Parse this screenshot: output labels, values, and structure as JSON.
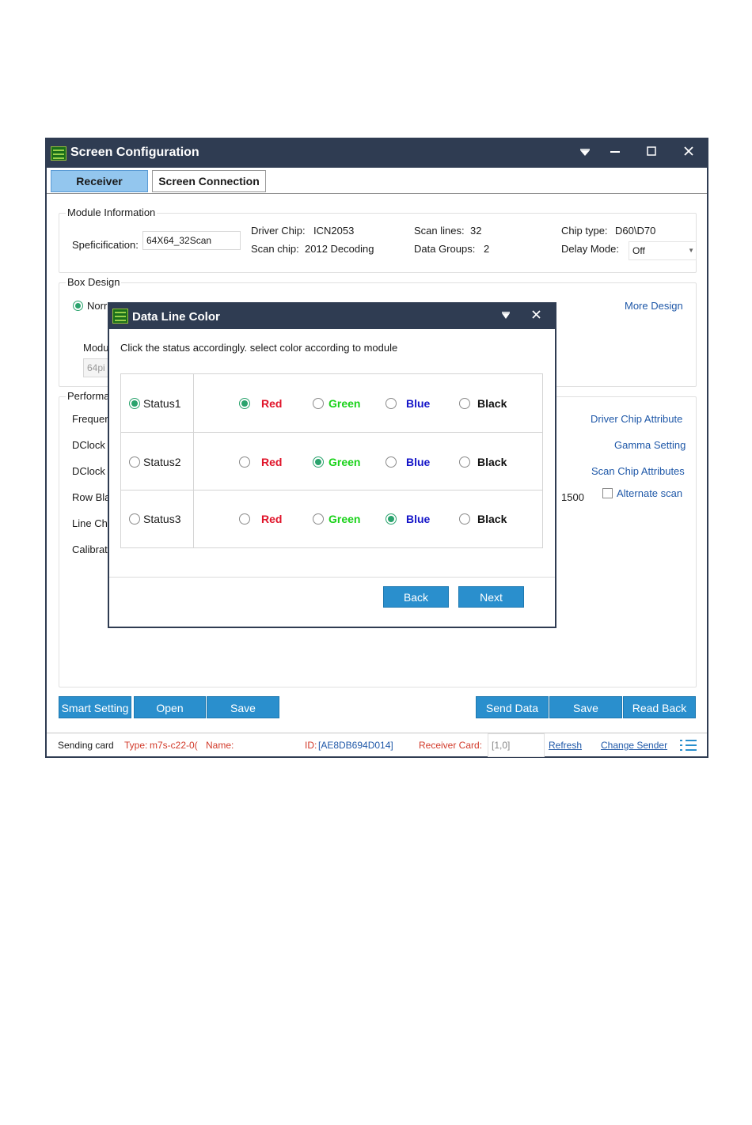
{
  "window": {
    "title": "Screen Configuration",
    "tabs": [
      "Receiver",
      "Screen Connection"
    ]
  },
  "module_info": {
    "group_title": "Module Information",
    "specification_label": "Speficification:",
    "specification_value": "64X64_32Scan",
    "driver_chip_label": "Driver Chip:",
    "driver_chip_value": "ICN2053",
    "scan_chip_label": "Scan chip:",
    "scan_chip_value": "2012 Decoding",
    "scan_lines_label": "Scan lines:",
    "scan_lines_value": "32",
    "data_groups_label": "Data Groups:",
    "data_groups_value": "2",
    "chip_type_label": "Chip type:",
    "chip_type_value": "D60\\D70",
    "delay_mode_label": "Delay Mode:",
    "delay_mode_value": "Off"
  },
  "box_design": {
    "group_title": "Box Design",
    "normal_design_partial": "Norr",
    "more_design": "More Design",
    "module_label_partial": "Modu",
    "module_field_partial": "64pi"
  },
  "performance": {
    "group_title_partial": "Performa",
    "rows_partial": [
      "Frequer",
      "DClock",
      "DClock",
      "Row Bla",
      "Line Cha",
      "Calibrat"
    ],
    "links": [
      "Driver Chip Attribute",
      "Gamma Setting",
      "Scan Chip Attributes"
    ],
    "value_1500": "1500",
    "alternate_scan": "Alternate scan"
  },
  "bottom_buttons": {
    "left": [
      "Smart Setting",
      "Open",
      "Save"
    ],
    "right": [
      "Send Data",
      "Save",
      "Read Back"
    ]
  },
  "statusbar": {
    "sending_card": "Sending card",
    "type_label": "Type:",
    "type_value": "m7s-c22-0(",
    "name_label": "Name:",
    "id_label": "ID:",
    "id_value": "[AE8DB694D014]",
    "receiver_card_label": "Receiver Card:",
    "receiver_card_value": "[1,0]",
    "refresh": "Refresh",
    "change_sender": "Change Sender"
  },
  "dialog": {
    "title": "Data Line Color",
    "instruction": "Click the status accordingly. select color according to module",
    "rows": [
      {
        "status": "Status1",
        "status_selected": true,
        "selected_color": "Red"
      },
      {
        "status": "Status2",
        "status_selected": false,
        "selected_color": "Green"
      },
      {
        "status": "Status3",
        "status_selected": false,
        "selected_color": "Blue"
      }
    ],
    "colors": [
      "Red",
      "Green",
      "Blue",
      "Black"
    ],
    "back": "Back",
    "next": "Next"
  },
  "colors": {
    "titlebar": "#2f3c52",
    "button": "#2a8fcd",
    "accent_radio": "#2aa36d"
  }
}
